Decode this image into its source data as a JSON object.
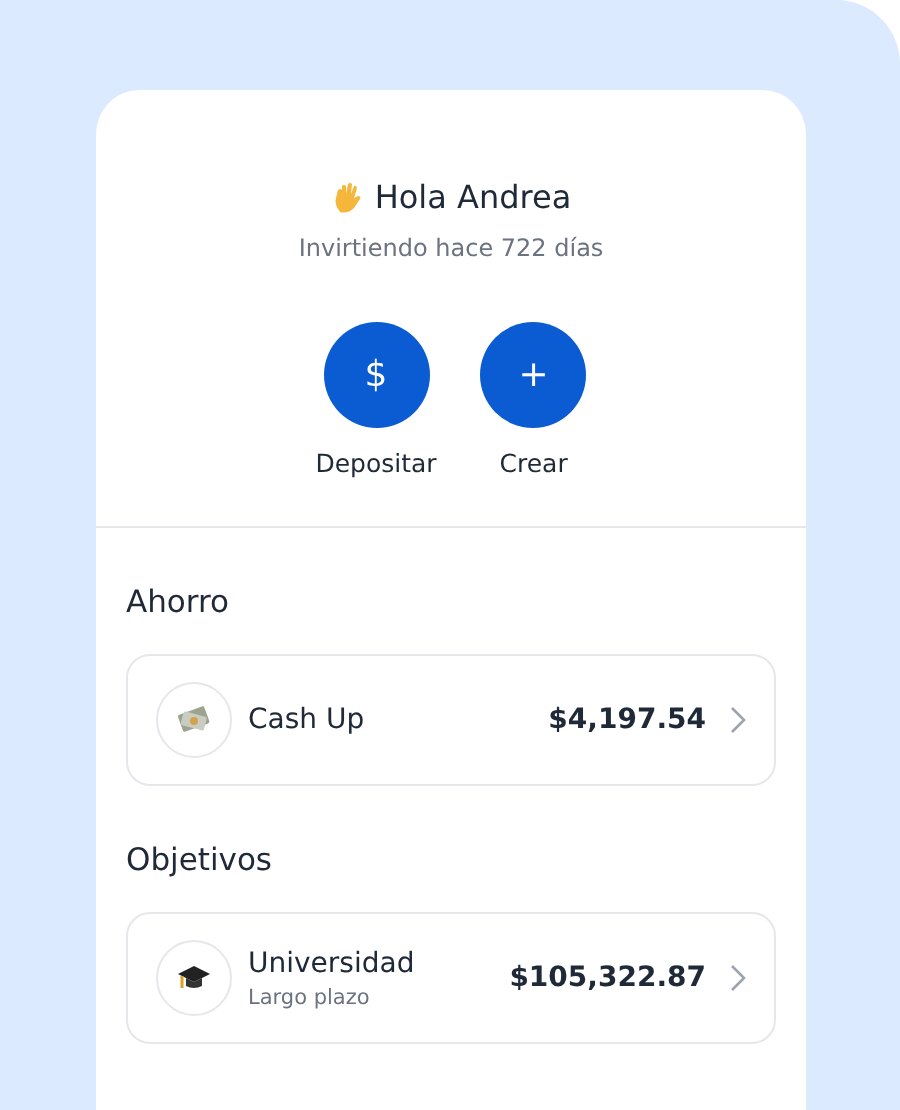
{
  "header": {
    "greeting": "Hola Andrea",
    "subtitle": "Invirtiendo hace 722 días"
  },
  "actions": [
    {
      "symbol": "$",
      "label": "Depositar"
    },
    {
      "symbol": "+",
      "label": "Crear"
    }
  ],
  "sections": [
    {
      "title": "Ahorro",
      "items": [
        {
          "kind": "cash",
          "name": "Cash Up",
          "amount": "$4,197.54"
        }
      ]
    },
    {
      "title": "Objetivos",
      "items": [
        {
          "kind": "graduation",
          "name": "Universidad",
          "detail": "Largo plazo",
          "amount": "$105,322.87"
        }
      ]
    }
  ]
}
